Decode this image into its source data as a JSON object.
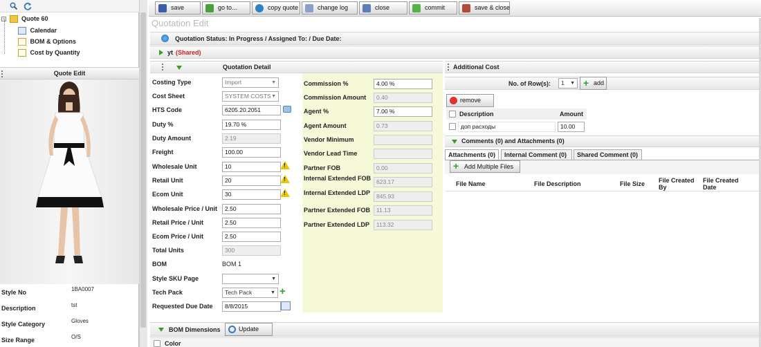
{
  "tree": {
    "root": "Quote 60",
    "items": [
      "Calendar",
      "BOM & Options",
      "Cost by Quantity"
    ]
  },
  "quote_edit_header": "Quote Edit",
  "style_info": [
    {
      "label": "Style No",
      "value": "1BA0007"
    },
    {
      "label": "Description",
      "value": "tst"
    },
    {
      "label": "Style Category",
      "value": "Gloves"
    },
    {
      "label": "Size Range",
      "value": "O/S"
    }
  ],
  "toolbar": {
    "save": "save",
    "goto": "go to...",
    "copy_quote": "copy quote",
    "change_log": "change log",
    "close": "close",
    "commit": "commit",
    "save_close": "save & close"
  },
  "title": "Quotation Edit",
  "status_text": "Quotation Status: In Progress / Assigned To: / Due Date:",
  "yt_label": "yt",
  "yt_shared": "(Shared)",
  "detail_header": "Quotation Detail",
  "additional_cost_header": "Additional Cost",
  "fields_left": [
    {
      "label": "Costing Type",
      "value": "Import"
    },
    {
      "label": "Cost Sheet",
      "value": "SYSTEM COSTS"
    },
    {
      "label": "HTS Code",
      "value": "6205.20.2051"
    },
    {
      "label": "Duty %",
      "value": "19.70 %"
    },
    {
      "label": "Duty Amount",
      "value": "2.19"
    },
    {
      "label": "Freight",
      "value": "100.00"
    },
    {
      "label": "Wholesale Unit",
      "value": "10"
    },
    {
      "label": "Retail Unit",
      "value": "20"
    },
    {
      "label": "Ecom Unit",
      "value": "30"
    },
    {
      "label": "Wholesale Price / Unit",
      "value": "2.50"
    },
    {
      "label": "Retail Price / Unit",
      "value": "2.50"
    },
    {
      "label": "Ecom Price / Unit",
      "value": "2.50"
    },
    {
      "label": "Total Units",
      "value": "300"
    },
    {
      "label": "BOM",
      "value": "BOM 1"
    },
    {
      "label": "Style SKU Page",
      "value": ""
    },
    {
      "label": "Tech Pack",
      "value": "Tech Pack"
    },
    {
      "label": "Requested Due Date",
      "value": "8/8/2015"
    }
  ],
  "fields_right": [
    {
      "label": "Commission %",
      "value": "4.00 %"
    },
    {
      "label": "Commission Amount",
      "value": "0.40"
    },
    {
      "label": "Agent %",
      "value": "7.00 %"
    },
    {
      "label": "Agent Amount",
      "value": "0.73"
    },
    {
      "label": "Vendor Minimum",
      "value": ""
    },
    {
      "label": "Vendor Lead Time",
      "value": ""
    },
    {
      "label": "Partner FOB",
      "value": "0.00"
    },
    {
      "label": "Internal Extended FOB",
      "value": "623.17"
    },
    {
      "label": "Internal Extended LDP",
      "value": "845.93"
    },
    {
      "label": "Partner Extended FOB",
      "value": "11.13"
    },
    {
      "label": "Partner Extended LDP",
      "value": "113.32"
    }
  ],
  "additional_cost": {
    "rows_label": "No. of Row(s):",
    "rows_value": "1",
    "add_label": "add",
    "remove_label": "remove",
    "col_description": "Description",
    "col_amount": "Amount",
    "row_description": "доп расходы",
    "row_amount": "10.00"
  },
  "comments_header": "Comments (0) and Attachments (0)",
  "tabs": [
    "Attachments (0)",
    "Internal Comment (0)",
    "Shared Comment (0)"
  ],
  "add_files_label": "Add Multiple Files",
  "file_columns": [
    "File Name",
    "File Description",
    "File Size",
    "File Created By",
    "File Created Date"
  ],
  "bom_dimensions_label": "BOM Dimensions",
  "update_label": "Update",
  "color_label": "Color",
  "colors": {
    "accent_green": "#3a9a2a",
    "shared_red": "#cc2222",
    "yellow_panel": "#f6f9d8"
  }
}
